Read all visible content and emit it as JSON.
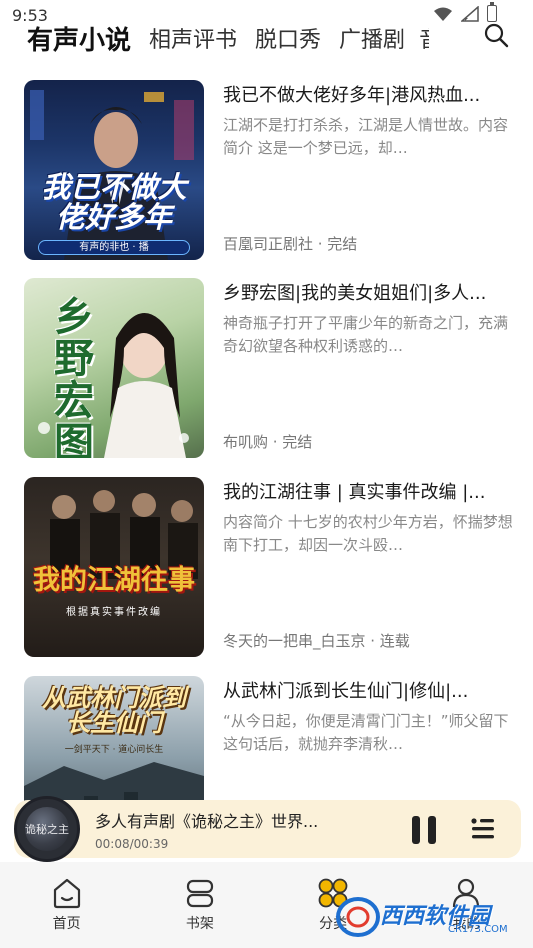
{
  "status_bar": {
    "time": "9:53"
  },
  "top_tabs": [
    "有声小说",
    "相声评书",
    "脱口秀",
    "广播剧",
    "音"
  ],
  "books": [
    {
      "title": "我已不做大佬好多年|港风热血...",
      "description": "江湖不是打打杀杀，江湖是人情世故。内容简介 这是一个梦已远，却…",
      "meta": "百凰司正剧社 · 完结",
      "cover_title": "我已不做大佬好多年",
      "cover_subtitle": "有声的非也 · 播"
    },
    {
      "title": "乡野宏图|我的美女姐姐们|多人...",
      "description": "神奇瓶子打开了平庸少年的新奇之门，充满奇幻欲望各种权利诱惑的…",
      "meta": "布叽购 · 完结",
      "cover_title": "乡野宏图"
    },
    {
      "title": "我的江湖往事 | 真实事件改编 |...",
      "description": "内容简介 十七岁的农村少年方岩，怀揣梦想南下打工，却因一次斗殴…",
      "meta": "冬天的一把串_白玉京 · 连载",
      "cover_title": "我的江湖往事",
      "cover_subtitle": "根据真实事件改编"
    },
    {
      "title": "从武林门派到长生仙门|修仙|...",
      "description": "“从今日起，你便是清霄门门主！”师父留下这句话后，就抛弃李清秋…",
      "meta": "",
      "cover_title": "从武林门派到长生仙门",
      "cover_subtitle": "一剑平天下 · 道心问长生"
    }
  ],
  "player": {
    "title": "多人有声剧《诡秘之主》世界...",
    "time": "00:08/00:39",
    "disc_text": "诡秘之主"
  },
  "bottom_nav": [
    {
      "label": "首页",
      "icon": "home-icon"
    },
    {
      "label": "书架",
      "icon": "bookshelf-icon"
    },
    {
      "label": "分类",
      "icon": "category-icon"
    },
    {
      "label": "我的",
      "icon": "profile-icon"
    }
  ],
  "watermark": {
    "text": "西西软件园",
    "url": "CR173.COM"
  },
  "colors": {
    "player_bg": "#fbf1d9",
    "nav_bg": "#f6f6f6",
    "category_accent": "#f2b600",
    "watermark_blue": "#1e6fd0",
    "watermark_red": "#e23c2e"
  }
}
